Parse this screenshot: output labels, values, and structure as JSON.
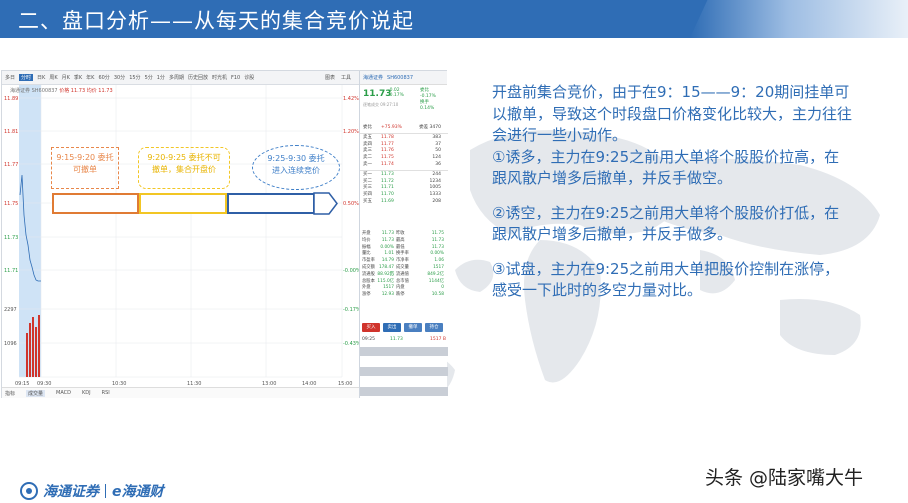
{
  "header": {
    "title": "二、盘口分析——从每天的集合竞价说起"
  },
  "software": {
    "toolbar": {
      "items": [
        "多日",
        "分时",
        "日K",
        "周K",
        "月K",
        "季K",
        "年K",
        "60分",
        "30分",
        "15分",
        "5分",
        "1分",
        "多周期",
        "历史回放",
        "时光机",
        "F10",
        "诊股"
      ],
      "active_index": 1,
      "right_items": [
        "图表",
        "工具"
      ]
    },
    "chart_legend": {
      "label": "海通证券 SH600837",
      "price_label": "价格 11.73",
      "avg_label": "均价 11.73"
    },
    "y_axis_left": [
      "11.89",
      "11.81",
      "11.77",
      "11.75",
      "11.73",
      "11.71",
      "2297",
      "1096"
    ],
    "y_axis_right": [
      "1.42%",
      "1.20%",
      "0.50%",
      "-0.00%",
      "-0.17%",
      "-0.43%"
    ],
    "x_axis": [
      "09:15",
      "09:30",
      "10:30",
      "11:30",
      "13:00",
      "14:00",
      "15:00"
    ],
    "bottom_tabs": [
      "成交量",
      "MACD",
      "KDJ",
      "RSI"
    ],
    "bottom_tabs_prefix": "指标",
    "quote": {
      "header": [
        "海通证券",
        "SH600837"
      ],
      "price": "11.73",
      "change": "-0.02",
      "change_pct": "-0.17%",
      "right_vals": [
        "委比",
        "-0.17%",
        "换手",
        "0.14%"
      ],
      "sub": "逐笔成交  09:27:10",
      "order_book": [
        {
          "k": "委比",
          "p": "+75.93%",
          "n": "委差 3470",
          "red": true
        },
        {
          "k": "卖五",
          "p": "11.78",
          "n": "383",
          "red": true
        },
        {
          "k": "卖四",
          "p": "11.77",
          "n": "37",
          "red": true
        },
        {
          "k": "卖三",
          "p": "11.76",
          "n": "50",
          "red": true
        },
        {
          "k": "卖二",
          "p": "11.75",
          "n": "124",
          "red": true
        },
        {
          "k": "卖一",
          "p": "11.74",
          "n": "36",
          "red": true
        },
        {
          "k": "买一",
          "p": "11.73",
          "n": "244",
          "red": false
        },
        {
          "k": "买二",
          "p": "11.72",
          "n": "1234",
          "red": false
        },
        {
          "k": "买三",
          "p": "11.71",
          "n": "1005",
          "red": false
        },
        {
          "k": "买四",
          "p": "11.70",
          "n": "1333",
          "red": false
        },
        {
          "k": "买五",
          "p": "11.69",
          "n": "208",
          "red": false
        }
      ],
      "stats": [
        [
          "开盘",
          "11.73",
          "昨收",
          "11.75"
        ],
        [
          "均价",
          "11.73",
          "最高",
          "11.73"
        ],
        [
          "振幅",
          "0.00%",
          "最低",
          "11.73"
        ],
        [
          "量比",
          "1.01",
          "换手率",
          "0.00%"
        ],
        [
          "市盈率",
          "14.79",
          "市净率",
          "1.06"
        ],
        [
          "成交额",
          "178.47万",
          "成交量",
          "1517"
        ],
        [
          "流通股",
          "88.92亿",
          "流通值",
          "849.2亿"
        ],
        [
          "总股本",
          "115.0亿",
          "总市值",
          "1144亿"
        ],
        [
          "外盘",
          "1517",
          "内盘",
          "0"
        ],
        [
          "涨停",
          "12.93",
          "跌停",
          "10.58"
        ]
      ],
      "buttons": [
        "买入",
        "卖出",
        "撤单",
        "持仓"
      ],
      "trade": [
        "09:25",
        "11.73",
        "1517 B"
      ]
    }
  },
  "annotations": {
    "box1": "9:15-9:20 委托\n可撤单",
    "box2": "9:20-9:25 委托不可\n撤单，集合开盘价",
    "box3": "9:25-9:30 委托\n进入连续竞价"
  },
  "explanation": {
    "p1": "开盘前集合竞价，由于在9：15——9：20期间挂单可以撤单，导致这个时段盘口价格变化比较大，主力往往会进行一些小动作。",
    "p2": "①诱多，主力在9:25之前用大单将个股股价拉高，在跟风散户增多后撤单，并反手做空。",
    "p3": "②诱空，主力在9:25之前用大单将个股股价打低，在跟风散户增多后撤单，并反手做多。",
    "p4": "③试盘，主力在9:25之前用大单把股价控制在涨停，感受一下此时的多空力量对比。"
  },
  "footer": {
    "logo": "海通证券",
    "logo2": "e海通财",
    "watermark": "头条 @陆家嘴大牛"
  },
  "colors": {
    "brand_blue": "#2f6db5",
    "up_red": "#d0342c",
    "down_green": "#2a9d48",
    "seg1": "#e07b34",
    "seg2": "#f2c624",
    "seg3": "#2f5fa6"
  }
}
